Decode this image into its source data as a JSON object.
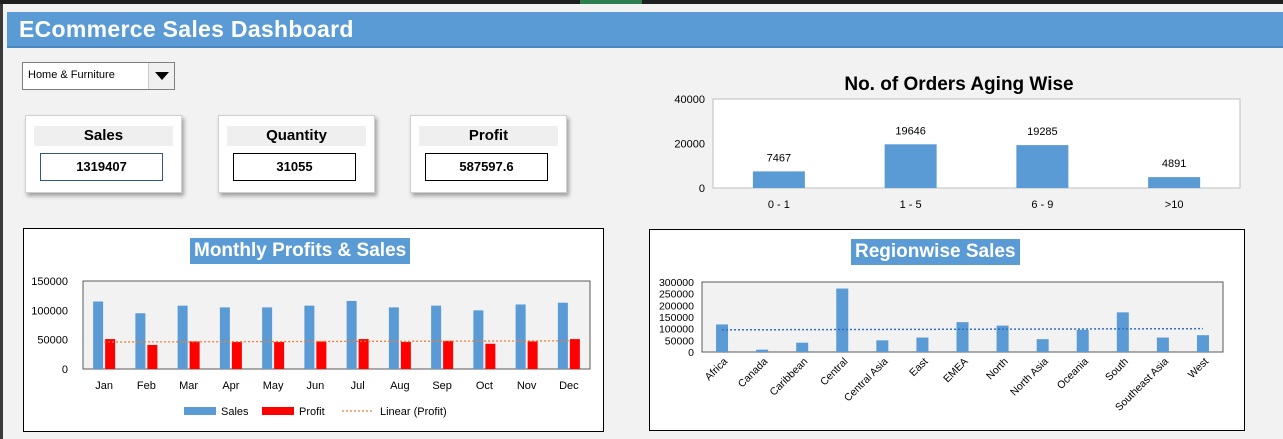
{
  "header": {
    "title": "ECommerce Sales Dashboard"
  },
  "filter": {
    "selected": "Home & Furniture",
    "icon": "chevron-down-icon"
  },
  "kpis": [
    {
      "label": "Sales",
      "value": "1319407"
    },
    {
      "label": "Quantity",
      "value": "31055"
    },
    {
      "label": "Profit",
      "value": "587597.6"
    }
  ],
  "colors": {
    "accent": "#5b9bd5",
    "sales": "#5b9bd5",
    "profit": "#ff0000",
    "trend": "#ed7d31"
  },
  "chart_data": [
    {
      "type": "bar",
      "title": "No. of Orders Aging Wise",
      "categories": [
        "0 - 1",
        "1 - 5",
        "6 - 9",
        ">10"
      ],
      "values": [
        7467,
        19646,
        19285,
        4891
      ],
      "ylim": [
        0,
        40000
      ],
      "yticks": [
        "0",
        "20000",
        "40000"
      ],
      "data_labels": [
        "7467",
        "19646",
        "19285",
        "4891"
      ],
      "grid": false
    },
    {
      "type": "bar",
      "title": "Monthly Profits & Sales",
      "categories": [
        "Jan",
        "Feb",
        "Mar",
        "Apr",
        "May",
        "Jun",
        "Jul",
        "Aug",
        "Sep",
        "Oct",
        "Nov",
        "Dec"
      ],
      "series": [
        {
          "name": "Sales",
          "values": [
            115000,
            95000,
            108000,
            105000,
            105000,
            108000,
            116000,
            105000,
            108000,
            100000,
            110000,
            113000
          ]
        },
        {
          "name": "Profit",
          "values": [
            51000,
            41000,
            47000,
            46000,
            46000,
            47000,
            51000,
            46000,
            48000,
            43000,
            47000,
            51000
          ]
        }
      ],
      "trendline": {
        "name": "Linear (Profit)",
        "from": 46000,
        "to": 48000
      },
      "ylim": [
        0,
        150000
      ],
      "yticks": [
        "0",
        "50000",
        "100000",
        "150000"
      ],
      "legend": "bottom",
      "grid": false
    },
    {
      "type": "bar",
      "title": "Regionwise Sales",
      "categories": [
        "Africa",
        "Canada",
        "Caribbean",
        "Central",
        "Central Asia",
        "East",
        "EMEA",
        "North",
        "North Asia",
        "Oceania",
        "South",
        "Southeast Asia",
        "West"
      ],
      "values": [
        118000,
        10000,
        40000,
        272000,
        50000,
        62000,
        128000,
        113000,
        55000,
        95000,
        170000,
        62000,
        72000
      ],
      "trendline": {
        "from": 95000,
        "to": 100000
      },
      "ylim": [
        0,
        300000
      ],
      "yticks": [
        "0",
        "50000",
        "100000",
        "150000",
        "200000",
        "250000",
        "300000"
      ],
      "grid": false
    }
  ]
}
